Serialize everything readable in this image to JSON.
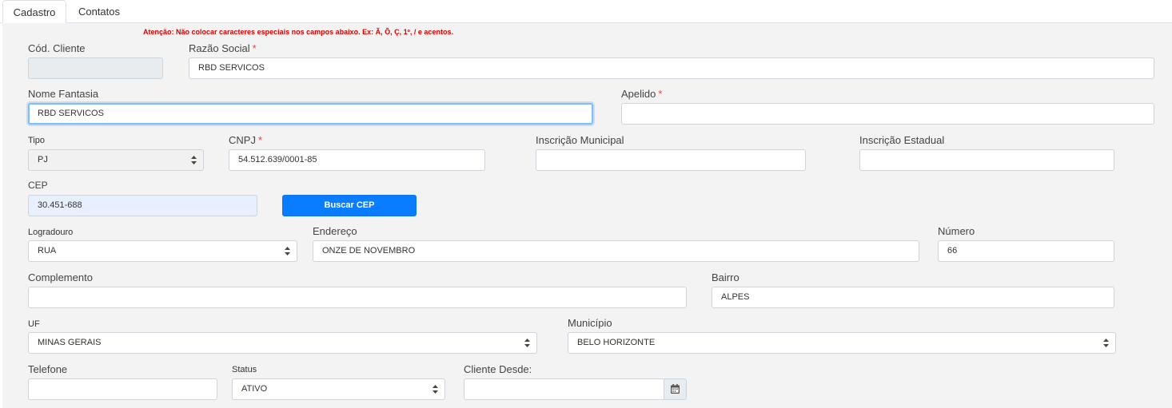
{
  "tabs": {
    "cadastro": "Cadastro",
    "contatos": "Contatos"
  },
  "warning": "Atenção: Não colocar caracteres especiais nos campos abaixo. Ex: Ã, Õ, Ç, 1º, / e acentos.",
  "required_mark": "*",
  "form": {
    "cod_cliente": {
      "label": "Cód. Cliente",
      "value": ""
    },
    "razao_social": {
      "label": "Razão Social",
      "value": "RBD SERVICOS"
    },
    "nome_fantasia": {
      "label": "Nome Fantasia",
      "value": "RBD SERVICOS"
    },
    "apelido": {
      "label": "Apelido",
      "value": ""
    },
    "tipo": {
      "label": "Tipo",
      "value": "PJ"
    },
    "cnpj": {
      "label": "CNPJ",
      "value": "54.512.639/0001-85"
    },
    "inscricao_municipal": {
      "label": "Inscrição Municipal",
      "value": ""
    },
    "inscricao_estadual": {
      "label": "Inscrição Estadual",
      "value": ""
    },
    "cep": {
      "label": "CEP",
      "value": "30.451-688"
    },
    "buscar_cep": "Buscar CEP",
    "logradouro": {
      "label": "Logradouro",
      "value": "RUA"
    },
    "endereco": {
      "label": "Endereço",
      "value": "ONZE DE NOVEMBRO"
    },
    "numero": {
      "label": "Número",
      "value": "66"
    },
    "complemento": {
      "label": "Complemento",
      "value": ""
    },
    "bairro": {
      "label": "Bairro",
      "value": "ALPES"
    },
    "uf": {
      "label": "UF",
      "value": "MINAS GERAIS"
    },
    "municipio": {
      "label": "Município",
      "value": "BELO HORIZONTE"
    },
    "telefone": {
      "label": "Telefone",
      "value": ""
    },
    "status": {
      "label": "Status",
      "value": "ATIVO"
    },
    "cliente_desde": {
      "label": "Cliente Desde:",
      "value": ""
    }
  },
  "icons": {
    "select_caret": "updown-caret-icon",
    "calendar": "calendar-icon"
  }
}
